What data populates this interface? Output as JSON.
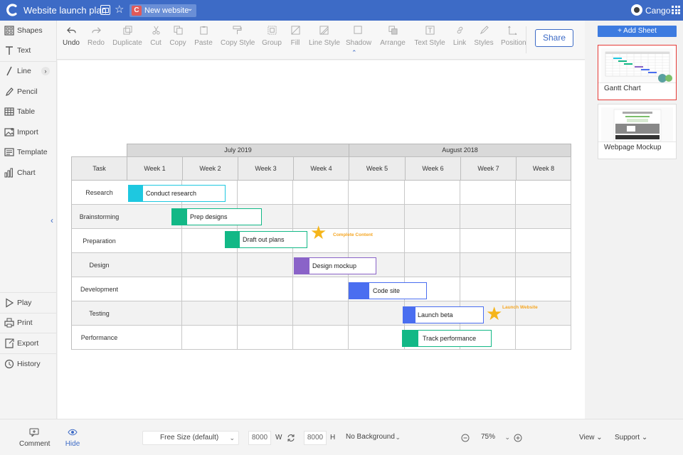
{
  "app": {
    "doc_title": "Website launch plan",
    "folder_badge": "C",
    "folder_name": "New website",
    "user_name": "Cango"
  },
  "left_tools": [
    {
      "label": "Shapes",
      "icon": "shapes-icon"
    },
    {
      "label": "Text",
      "icon": "text-icon"
    },
    {
      "label": "Line",
      "icon": "line-icon"
    },
    {
      "label": "Pencil",
      "icon": "pencil-icon"
    },
    {
      "label": "Table",
      "icon": "table-icon"
    },
    {
      "label": "Import",
      "icon": "image-import-icon"
    },
    {
      "label": "Template",
      "icon": "template-icon"
    },
    {
      "label": "Chart",
      "icon": "bar-chart-icon"
    }
  ],
  "left_actions": [
    {
      "label": "Play",
      "icon": "play-icon"
    },
    {
      "label": "Print",
      "icon": "printer-icon"
    },
    {
      "label": "Export",
      "icon": "export-icon"
    },
    {
      "label": "History",
      "icon": "history-icon"
    }
  ],
  "toolbar": {
    "undo": "Undo",
    "redo": "Redo",
    "duplicate": "Duplicate",
    "cut": "Cut",
    "copy": "Copy",
    "paste": "Paste",
    "copy_style": "Copy Style",
    "group": "Group",
    "fill": "Fill",
    "line_style": "Line Style",
    "shadow": "Shadow",
    "arrange": "Arrange",
    "text_style": "Text Style",
    "link": "Link",
    "styles": "Styles",
    "position": "Position",
    "share": "Share"
  },
  "gantt": {
    "months": [
      "July 2019",
      "August 2018"
    ],
    "task_header": "Task",
    "weeks": [
      "Week 1",
      "Week 2",
      "Week 3",
      "Week 4",
      "Week 5",
      "Week 6",
      "Week 7",
      "Week 8"
    ],
    "tasks": [
      "Research",
      "Brainstorming",
      "Preparation",
      "Design",
      "Development",
      "Testing",
      "Performance"
    ],
    "bars": [
      {
        "label": "Conduct research",
        "color": "#1ec8e0"
      },
      {
        "label": "Prep designs",
        "color": "#12b886"
      },
      {
        "label": "Draft out plans",
        "color": "#12b886"
      },
      {
        "label": "Design mockup",
        "color": "#8a63c8"
      },
      {
        "label": "Code site",
        "color": "#4a6ef0"
      },
      {
        "label": "Launch beta",
        "color": "#4a6ef0"
      },
      {
        "label": "Track performance",
        "color": "#12b886"
      }
    ],
    "milestones": [
      {
        "label": "Complete Content",
        "color": "#f5b51a"
      },
      {
        "label": "Launch Website",
        "color": "#f5b51a"
      }
    ]
  },
  "right_panel": {
    "add_sheet": "+ Add Sheet",
    "sheets": [
      {
        "name": "Gantt Chart",
        "active": true
      },
      {
        "name": "Webpage Mockup",
        "active": false
      }
    ]
  },
  "bottom": {
    "comment": "Comment",
    "hide": "Hide",
    "page_size": "Free Size (default)",
    "width": "8000",
    "width_label": "W",
    "height": "8000",
    "height_label": "H",
    "background": "No Background",
    "zoom": "75%",
    "view": "View",
    "support": "Support"
  }
}
